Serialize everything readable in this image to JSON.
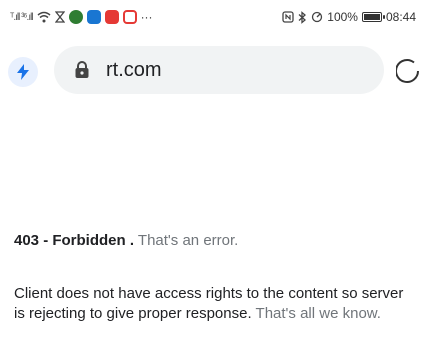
{
  "status_bar": {
    "signal_text": "ᵀ.ıll ³⁶.ıll",
    "battery_label": "100%",
    "battery_level": 1.0,
    "time": "08:44",
    "more_indicator": "···",
    "app_icon_colors": [
      "#2f7d32",
      "#1976d2",
      "#e53935",
      "#e53935"
    ]
  },
  "address_bar": {
    "url": "rt.com",
    "lightning_icon": "bolt-icon",
    "lock_icon": "lock-icon",
    "reload_icon": "reload-icon"
  },
  "error": {
    "code_text": "403 - Forbidden .",
    "tagline": "That's an error.",
    "message": "Client does not have access rights to the content so server is rejecting to give proper response.",
    "suffix": "That's all we know."
  },
  "colors": {
    "accent": "#1a73e8",
    "muted_text": "#70757a",
    "pill_bg": "#f1f3f4"
  }
}
